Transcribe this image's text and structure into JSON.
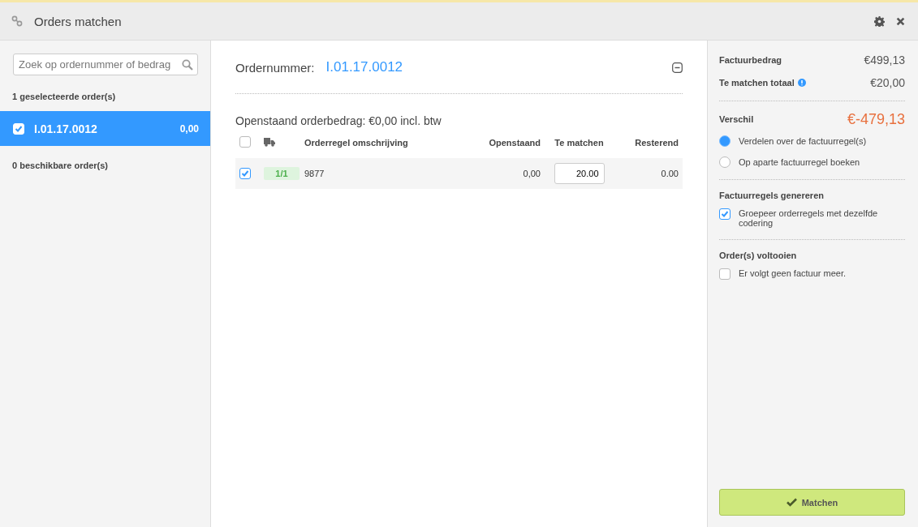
{
  "window": {
    "title": "Orders matchen"
  },
  "sidebar": {
    "search": {
      "placeholder": "Zoek op ordernummer of bedrag"
    },
    "selected_heading": "1 geselecteerde order(s)",
    "selected_orders": [
      {
        "number": "I.01.17.0012",
        "amount": "0,00",
        "checked": true,
        "selected": true
      }
    ],
    "available_heading": "0 beschikbare order(s)"
  },
  "order": {
    "label": "Ordernummer:",
    "number": "I.01.17.0012",
    "outstanding": "Openstaand orderbedrag: €0,00 incl. btw",
    "table": {
      "all_checked": false,
      "columns": [
        "Orderregel omschrijving",
        "Openstaand",
        "Te matchen",
        "Resterend"
      ],
      "rows": [
        {
          "checked": true,
          "delivery": "1/1",
          "description": "9877",
          "outstanding": "0,00",
          "to_match": "20.00",
          "remaining": "0.00"
        }
      ]
    }
  },
  "summary": {
    "invoice_label": "Factuurbedrag",
    "invoice_amount": "€499,13",
    "total_label": "Te matchen totaal",
    "total_amount": "€20,00",
    "difference_label": "Verschil",
    "difference_amount": "€-479,13",
    "options": [
      {
        "label": "Verdelen over de factuurregel(s)",
        "selected": true
      },
      {
        "label": "Op aparte factuurregel boeken",
        "selected": false
      }
    ],
    "generate_heading": "Factuurregels genereren",
    "group_option": {
      "label": "Groepeer orderregels met dezelfde codering",
      "checked": true
    },
    "complete_heading": "Order(s) voltooien",
    "final_option": {
      "label": "Er volgt geen factuur meer.",
      "checked": false
    },
    "button": "Matchen"
  }
}
